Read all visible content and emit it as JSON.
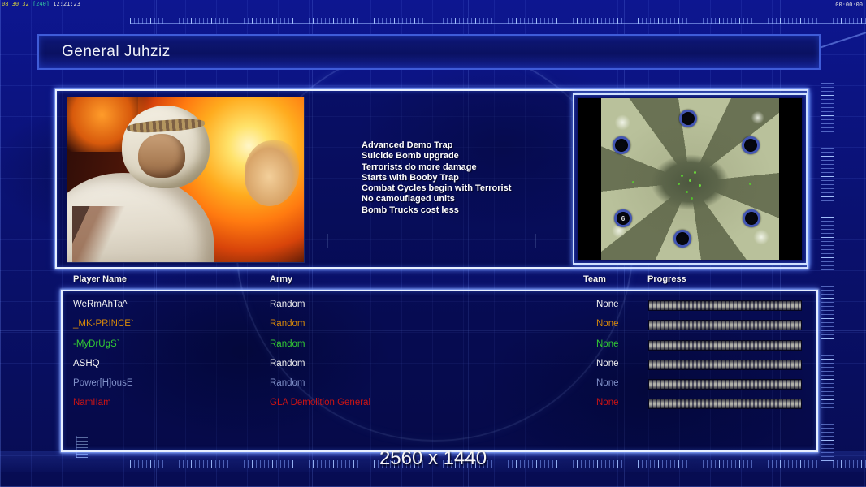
{
  "hud": {
    "frame_stats": "08 30 32",
    "frame_bracket": "[240]",
    "clock": "12:21:23",
    "match_timer": "00:00:00",
    "resolution_label": "2560 x 1440"
  },
  "header": {
    "title": "General Juhziz"
  },
  "general_info": {
    "perks": [
      "Advanced Demo Trap",
      "Suicide Bomb upgrade",
      "Terrorists do more damage",
      "Starts with Booby Trap",
      "Combat Cycles begin with Terrorist",
      "No camouflaged units",
      "Bomb Trucks cost less"
    ]
  },
  "minimap": {
    "start_position_label": "6"
  },
  "player_table": {
    "columns": [
      "Player Name",
      "Army",
      "Team",
      "Progress"
    ],
    "rows": [
      {
        "name": "WeRmAhTa^",
        "army": "Random",
        "team": "None",
        "color": "#f2f2f2",
        "progress": 100
      },
      {
        "name": "_MK-PRINCE`",
        "army": "Random",
        "team": "None",
        "color": "#d7890a",
        "progress": 100
      },
      {
        "name": "-MyDrUgS`",
        "army": "Random",
        "team": "None",
        "color": "#33cc33",
        "progress": 100
      },
      {
        "name": "ASHQ",
        "army": "Random",
        "team": "None",
        "color": "#f2f2f2",
        "progress": 100
      },
      {
        "name": "Power[H]ousE",
        "army": "Random",
        "team": "None",
        "color": "#8090c8",
        "progress": 100
      },
      {
        "name": "NamIIam",
        "army": "GLA Demolition General",
        "team": "None",
        "color": "#cc1414",
        "progress": 100
      }
    ]
  },
  "colors": {
    "background": "#0a1173",
    "panel_border": "#3f5cd8",
    "panel_glow": "#cfe0ff",
    "progress_segment": "#9a9a90"
  }
}
